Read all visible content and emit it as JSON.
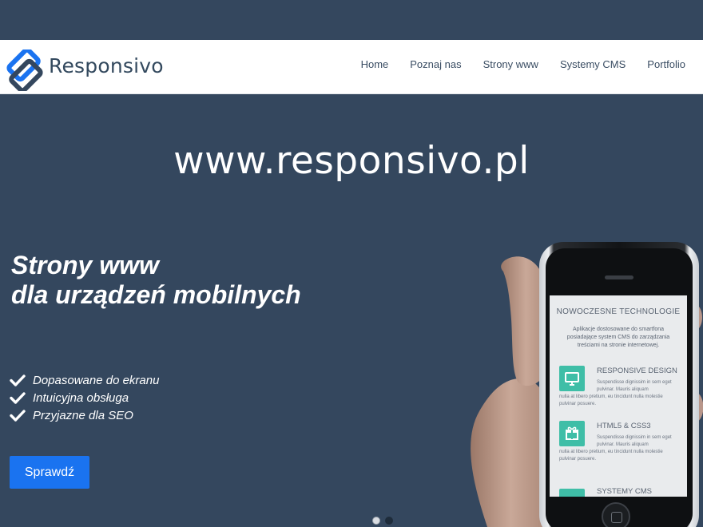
{
  "brand": {
    "name": "Responsivo",
    "logo_colors": [
      "#1a73f0",
      "#34475e"
    ]
  },
  "nav": {
    "items": [
      {
        "label": "Home"
      },
      {
        "label": "Poznaj nas"
      },
      {
        "label": "Strony www"
      },
      {
        "label": "Systemy CMS"
      },
      {
        "label": "Portfolio"
      }
    ]
  },
  "hero": {
    "url_text": "www.responsivo.pl",
    "headline_line1": "Strony www",
    "headline_line2": "dla urządzeń mobilnych",
    "features": [
      {
        "icon": "check-icon",
        "label": "Dopasowane do ekranu"
      },
      {
        "icon": "check-icon",
        "label": "Intuicyjna obsługa"
      },
      {
        "icon": "check-icon",
        "label": "Przyjazne dla SEO"
      }
    ],
    "cta_label": "Sprawdź"
  },
  "carousel": {
    "slide_count": 2,
    "active_index": 0
  },
  "phone_screen": {
    "title": "NOWOCZESNE TECHNOLOGIE",
    "description": "Aplikacje dostosowane do smartfona posiadające system CMS do zarządzania treściami na stronie internetowej.",
    "items": [
      {
        "icon": "monitor-icon",
        "title": "RESPONSIVE DESIGN",
        "text_a": "Suspendisse dignissim in sem eget pulvinar. Mauris aliquam",
        "text_b": "nulla at libero pretium, eu tincidunt nulla molestie pulvinar posuere."
      },
      {
        "icon": "gift-icon",
        "title": "HTML5 & CSS3",
        "text_a": "Suspendisse dignissim in sem eget pulvinar. Mauris aliquam",
        "text_b": "nulla at libero pretium, eu tincidunt nulla molestie pulvinar posuere."
      },
      {
        "icon": "cms-icon",
        "title": "SYSTEMY CMS"
      }
    ]
  },
  "colors": {
    "background": "#34475e",
    "accent": "#1a73f0",
    "teal": "#3fbea7"
  }
}
